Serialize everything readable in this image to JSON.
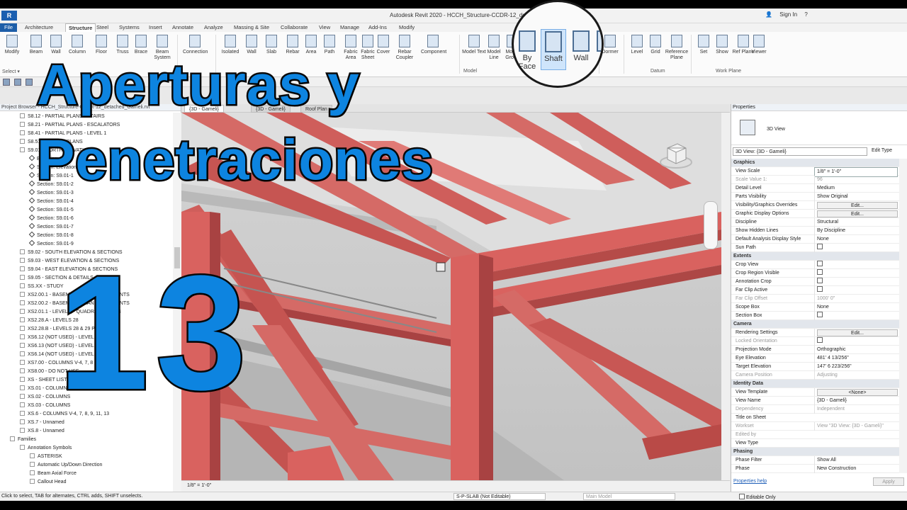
{
  "window": {
    "app_badge": "R",
    "title": "Autodesk Revit 2020 - HCCH_Structure-CCDR-12_det... - [3D - Gameli]",
    "sign_in": "Sign In",
    "help": "?"
  },
  "tabs": [
    {
      "label": "File"
    },
    {
      "label": "Architecture"
    },
    {
      "label": "Structure"
    },
    {
      "label": "Steel"
    },
    {
      "label": "Systems"
    },
    {
      "label": "Insert"
    },
    {
      "label": "Annotate"
    },
    {
      "label": "Analyze"
    },
    {
      "label": "Massing & Site"
    },
    {
      "label": "Collaborate"
    },
    {
      "label": "View"
    },
    {
      "label": "Manage"
    },
    {
      "label": "Add-Ins"
    },
    {
      "label": "Modify"
    }
  ],
  "ribbon": {
    "buttons": [
      "Modify",
      "Beam",
      "Wall",
      "Column",
      "Floor",
      "Truss",
      "Brace",
      "Beam System",
      "Connection",
      "Isolated",
      "Wall",
      "Slab",
      "Rebar",
      "Area",
      "Path",
      "Fabric Area",
      "Fabric Sheet",
      "Cover",
      "Rebar Coupler",
      "Component",
      "Model Text",
      "Model Line",
      "Model Group",
      "Dormer",
      "Level",
      "Grid",
      "Reference Plane",
      "Set",
      "Show",
      "Ref Plane",
      "Viewer"
    ],
    "groups": [
      "Select",
      "Model",
      "Datum",
      "Work Plane"
    ],
    "select_label": "Select ▾"
  },
  "magnifier": {
    "buttons": [
      "By Face",
      "Shaft",
      "Wall",
      "V"
    ],
    "group": "Op"
  },
  "overlay": {
    "line1": "Aperturas y",
    "line2": "Penetraciones",
    "number": "13"
  },
  "browser": {
    "header": "Project Browser - HCCH_Structure-CCDR-12_detached_Gameli.rvt",
    "tree": [
      {
        "text": "S8.12 - PARTIAL PLANS - STAIRS",
        "type": "toggle",
        "indent": 1
      },
      {
        "text": "S8.21 - PARTIAL PLANS - ESCALATORS",
        "type": "toggle",
        "indent": 1
      },
      {
        "text": "S8.41 - PARTIAL PLANS - LEVEL 1",
        "type": "toggle",
        "indent": 1
      },
      {
        "text": "S8.51 - PARTIAL PLANS",
        "type": "toggle",
        "indent": 1
      },
      {
        "text": "S9.01 - NORTH ELEVATION",
        "type": "toggle",
        "indent": 1
      },
      {
        "text": "Elevation: North",
        "type": "view",
        "indent": 2
      },
      {
        "text": "Section: Elevation",
        "type": "view",
        "indent": 2
      },
      {
        "text": "Section: S9.01-1",
        "type": "view",
        "indent": 2
      },
      {
        "text": "Section: S9.01-2",
        "type": "view",
        "indent": 2
      },
      {
        "text": "Section: S9.01-3",
        "type": "view",
        "indent": 2
      },
      {
        "text": "Section: S9.01-4",
        "type": "view",
        "indent": 2
      },
      {
        "text": "Section: S9.01-5",
        "type": "view",
        "indent": 2
      },
      {
        "text": "Section: S9.01-6",
        "type": "view",
        "indent": 2
      },
      {
        "text": "Section: S9.01-7",
        "type": "view",
        "indent": 2
      },
      {
        "text": "Section: S9.01-8",
        "type": "view",
        "indent": 2
      },
      {
        "text": "Section: S9.01-9",
        "type": "view",
        "indent": 2
      },
      {
        "text": "S9.02 - SOUTH ELEVATION & SECTIONS",
        "type": "toggle",
        "indent": 1
      },
      {
        "text": "S9.03 - WEST ELEVATION & SECTIONS",
        "type": "toggle",
        "indent": 1
      },
      {
        "text": "S9.04 - EAST ELEVATION & SECTIONS",
        "type": "toggle",
        "indent": 1
      },
      {
        "text": "S9.05 - SECTION & DETAILS",
        "type": "toggle",
        "indent": 1
      },
      {
        "text": "SS.XX - STUDY",
        "type": "toggle",
        "indent": 1
      },
      {
        "text": "XS2.00.1 - BASEMENT PLAN - QUADRANTS",
        "type": "toggle",
        "indent": 1
      },
      {
        "text": "XS2.00.2 - BASEMENT PLAN - QUADRANTS",
        "type": "toggle",
        "indent": 1
      },
      {
        "text": "XS2.01.1 - LEVEL 1 - QUADRANTS A & B",
        "type": "toggle",
        "indent": 1
      },
      {
        "text": "XS2.28.A - LEVELS 28",
        "type": "toggle",
        "indent": 1
      },
      {
        "text": "XS2.28.B - LEVELS 28 & 29 PLAN",
        "type": "toggle",
        "indent": 1
      },
      {
        "text": "XS6.12 (NOT USED) - LEVEL",
        "type": "toggle",
        "indent": 1
      },
      {
        "text": "XS6.13 (NOT USED) - LEVEL",
        "type": "toggle",
        "indent": 1
      },
      {
        "text": "XS6.14 (NOT USED) - LEVEL 4",
        "type": "toggle",
        "indent": 1
      },
      {
        "text": "XS7.00 - COLUMNS V-4, 7, 8",
        "type": "toggle",
        "indent": 1
      },
      {
        "text": "XS8.00 - DO NOT USE",
        "type": "toggle",
        "indent": 1
      },
      {
        "text": "XS - SHEET LIST",
        "type": "toggle",
        "indent": 1
      },
      {
        "text": "XS.01 - COLUMNS",
        "type": "toggle",
        "indent": 1
      },
      {
        "text": "XS.02 - COLUMNS",
        "type": "toggle",
        "indent": 1
      },
      {
        "text": "XS.03 - COLUMNS",
        "type": "toggle",
        "indent": 1
      },
      {
        "text": "XS.6 - COLUMNS V-4, 7, 8, 9, 11, 13",
        "type": "toggle",
        "indent": 1
      },
      {
        "text": "XS.7 - Unnamed",
        "type": "toggle",
        "indent": 1
      },
      {
        "text": "XS.8 - Unnamed",
        "type": "toggle",
        "indent": 1
      },
      {
        "text": "Families",
        "type": "toggle",
        "indent": 0
      },
      {
        "text": "Annotation Symbols",
        "type": "toggle",
        "indent": 1
      },
      {
        "text": "ASTERISK",
        "type": "toggle",
        "indent": 2
      },
      {
        "text": "Automatic Up/Down Direction",
        "type": "toggle",
        "indent": 2
      },
      {
        "text": "Beam Axial Force",
        "type": "toggle",
        "indent": 2
      },
      {
        "text": "Callout Head",
        "type": "toggle",
        "indent": 2
      }
    ]
  },
  "view_tabs": [
    {
      "label": "{3D - Gameli}",
      "active": true
    },
    {
      "label": "{3D - Gameli}",
      "active": false
    },
    {
      "label": "Roof Plan",
      "active": false
    }
  ],
  "view_status": {
    "scale": "1/8\" = 1'-0\""
  },
  "properties": {
    "title": "Properties",
    "type_name": "3D View",
    "selector": "3D View: {3D - Gameli}",
    "edit_type": "Edit Type",
    "rows": [
      {
        "section": "Graphics"
      },
      {
        "k": "View Scale",
        "v": "1/8\" = 1'-0\"",
        "style": "box"
      },
      {
        "k": "Scale Value    1:",
        "v": "96",
        "style": "dim"
      },
      {
        "k": "Detail Level",
        "v": "Medium"
      },
      {
        "k": "Parts Visibility",
        "v": "Show Original"
      },
      {
        "k": "Visibility/Graphics Overrides",
        "v": "Edit...",
        "style": "button"
      },
      {
        "k": "Graphic Display Options",
        "v": "Edit...",
        "style": "button"
      },
      {
        "k": "Discipline",
        "v": "Structural"
      },
      {
        "k": "Show Hidden Lines",
        "v": "By Discipline"
      },
      {
        "k": "Default Analysis Display Style",
        "v": "None"
      },
      {
        "k": "Sun Path",
        "v": "",
        "style": "check"
      },
      {
        "section": "Extents"
      },
      {
        "k": "Crop View",
        "v": "",
        "style": "check"
      },
      {
        "k": "Crop Region Visible",
        "v": "",
        "style": "check"
      },
      {
        "k": "Annotation Crop",
        "v": "",
        "style": "check"
      },
      {
        "k": "Far Clip Active",
        "v": "",
        "style": "check"
      },
      {
        "k": "Far Clip Offset",
        "v": "1000' 0\"",
        "style": "dim"
      },
      {
        "k": "Scope Box",
        "v": "None"
      },
      {
        "k": "Section Box",
        "v": "",
        "style": "check"
      },
      {
        "section": "Camera"
      },
      {
        "k": "Rendering Settings",
        "v": "Edit...",
        "style": "button"
      },
      {
        "k": "Locked Orientation",
        "v": "",
        "style": "dimcheck"
      },
      {
        "k": "Projection Mode",
        "v": "Orthographic"
      },
      {
        "k": "Eye Elevation",
        "v": "481'  4 13/256\""
      },
      {
        "k": "Target Elevation",
        "v": "147'  6 223/256\""
      },
      {
        "k": "Camera Position",
        "v": "Adjusting",
        "style": "dim"
      },
      {
        "section": "Identity Data"
      },
      {
        "k": "View Template",
        "v": "<None>",
        "style": "button"
      },
      {
        "k": "View Name",
        "v": "{3D - Gameli}"
      },
      {
        "k": "Dependency",
        "v": "Independent",
        "style": "dim"
      },
      {
        "k": "Title on Sheet",
        "v": ""
      },
      {
        "k": "Workset",
        "v": "View \"3D View: {3D - Gameli}\"",
        "style": "dim"
      },
      {
        "k": "Edited by",
        "v": "",
        "style": "dim"
      },
      {
        "k": "View Type",
        "v": ""
      },
      {
        "section": "Phasing"
      },
      {
        "k": "Phase Filter",
        "v": "Show All"
      },
      {
        "k": "Phase",
        "v": "New Construction"
      }
    ],
    "help_link": "Properties help",
    "apply": "Apply"
  },
  "statusbar": {
    "hint": "Click to select, TAB for alternates, CTRL adds, SHIFT unselects.",
    "workset": "S-P-SLAB (Not Editable)",
    "model": "Main Model",
    "editable_only": "Editable Only"
  },
  "colors": {
    "steel": "#d9625f",
    "steel_dark": "#a84242",
    "accent": "#1d5ea8",
    "overlay_text": "#0d84e0"
  }
}
